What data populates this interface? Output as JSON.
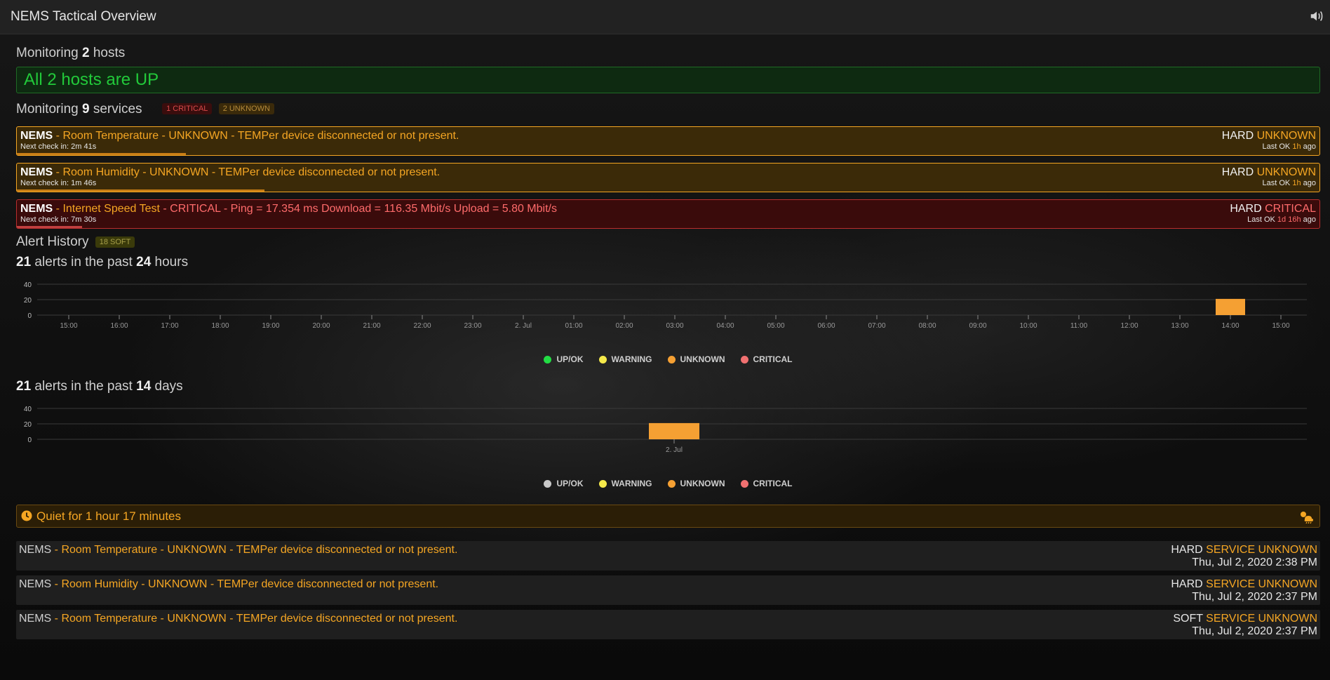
{
  "app_title": "NEMS Tactical Overview",
  "hosts": {
    "prefix": "Monitoring",
    "count": "2",
    "suffix": "hosts",
    "banner": "All 2 hosts are UP"
  },
  "services": {
    "prefix": "Monitoring",
    "count": "9",
    "suffix": "services",
    "badge_critical": "1 CRITICAL",
    "badge_unknown": "2 UNKNOWN"
  },
  "service_rows": [
    {
      "host": "NEMS",
      "sep": " - ",
      "desc": "Room Temperature - UNKNOWN - TEMPer device disconnected or not present.",
      "next_check": "Next check in: 2m 41s",
      "state_type": "HARD ",
      "state": "UNKNOWN",
      "last_ok_prefix": "Last OK ",
      "last_ok_value": "1h",
      "last_ok_suffix": " ago",
      "progress": 0.13
    },
    {
      "host": "NEMS",
      "sep": " - ",
      "desc": "Room Humidity - UNKNOWN - TEMPer device disconnected or not present.",
      "next_check": "Next check in: 1m 46s",
      "state_type": "HARD ",
      "state": "UNKNOWN",
      "last_ok_prefix": "Last OK ",
      "last_ok_value": "1h",
      "last_ok_suffix": " ago",
      "progress": 0.19
    },
    {
      "host": "NEMS",
      "sep": " - ",
      "desc_part1": "Internet Speed Test",
      "desc_part2": " - CRITICAL - Ping = 17.354 ms Download = 116.35 Mbit/s Upload = 5.80 Mbit/s",
      "next_check": "Next check in: 7m 30s",
      "state_type": "HARD ",
      "state": "CRITICAL",
      "last_ok_prefix": "Last OK ",
      "last_ok_value": "1d 16h",
      "last_ok_suffix": " ago",
      "progress": 0.05
    }
  ],
  "alert_history": {
    "title": "Alert History",
    "soft_badge": "18 SOFT"
  },
  "chart24": {
    "count": "21",
    "mid": "alerts in the past",
    "period": "24",
    "unit": "hours"
  },
  "chart14": {
    "count": "21",
    "mid": "alerts in the past",
    "period": "14",
    "unit": "days"
  },
  "legend": [
    {
      "label": "UP/OK",
      "color": "#22dd44"
    },
    {
      "label": "WARNING",
      "color": "#f5e94a"
    },
    {
      "label": "UNKNOWN",
      "color": "#f5a033"
    },
    {
      "label": "CRITICAL",
      "color": "#f07070"
    }
  ],
  "legend2_first_color": "#c8c8c8",
  "chart_data": [
    {
      "type": "bar",
      "categories": [
        "15:00",
        "16:00",
        "17:00",
        "18:00",
        "19:00",
        "20:00",
        "21:00",
        "22:00",
        "23:00",
        "2. Jul",
        "01:00",
        "02:00",
        "03:00",
        "04:00",
        "05:00",
        "06:00",
        "07:00",
        "08:00",
        "09:00",
        "10:00",
        "11:00",
        "12:00",
        "13:00",
        "14:00",
        "15:00"
      ],
      "series": [
        {
          "name": "UP/OK",
          "values": [
            0,
            0,
            0,
            0,
            0,
            0,
            0,
            0,
            0,
            0,
            0,
            0,
            0,
            0,
            0,
            0,
            0,
            0,
            0,
            0,
            0,
            0,
            0,
            0,
            0
          ]
        },
        {
          "name": "WARNING",
          "values": [
            0,
            0,
            0,
            0,
            0,
            0,
            0,
            0,
            0,
            0,
            0,
            0,
            0,
            0,
            0,
            0,
            0,
            0,
            0,
            0,
            0,
            0,
            0,
            0,
            0
          ]
        },
        {
          "name": "UNKNOWN",
          "values": [
            0,
            0,
            0,
            0,
            0,
            0,
            0,
            0,
            0,
            0,
            0,
            0,
            0,
            0,
            0,
            0,
            0,
            0,
            0,
            0,
            0,
            0,
            0,
            21,
            0
          ]
        },
        {
          "name": "CRITICAL",
          "values": [
            0,
            0,
            0,
            0,
            0,
            0,
            0,
            0,
            0,
            0,
            0,
            0,
            0,
            0,
            0,
            0,
            0,
            0,
            0,
            0,
            0,
            0,
            0,
            0,
            0
          ]
        }
      ],
      "yticks": [
        "0",
        "20",
        "40"
      ],
      "ylim": [
        0,
        40
      ],
      "grid": true,
      "legend_position": "bottom"
    },
    {
      "type": "bar",
      "categories": [
        "2. Jul"
      ],
      "series": [
        {
          "name": "UP/OK",
          "values": [
            0
          ]
        },
        {
          "name": "WARNING",
          "values": [
            0
          ]
        },
        {
          "name": "UNKNOWN",
          "values": [
            21
          ]
        },
        {
          "name": "CRITICAL",
          "values": [
            0
          ]
        }
      ],
      "yticks": [
        "0",
        "20",
        "40"
      ],
      "ylim": [
        0,
        40
      ],
      "grid": true,
      "legend_position": "bottom"
    }
  ],
  "quiet": {
    "text": "Quiet for 1 hour 17 minutes"
  },
  "history_rows": [
    {
      "host": "NEMS",
      "sep": " - ",
      "desc": "Room Temperature - UNKNOWN - TEMPer device disconnected or not present.",
      "type": "HARD ",
      "state": "SERVICE UNKNOWN",
      "time": "Thu, Jul 2, 2020 2:38 PM"
    },
    {
      "host": "NEMS",
      "sep": " - ",
      "desc": "Room Humidity - UNKNOWN - TEMPer device disconnected or not present.",
      "type": "HARD ",
      "state": "SERVICE UNKNOWN",
      "time": "Thu, Jul 2, 2020 2:37 PM"
    },
    {
      "host": "NEMS",
      "sep": " - ",
      "desc": "Room Temperature - UNKNOWN - TEMPer device disconnected or not present.",
      "type": "SOFT ",
      "state": "SERVICE UNKNOWN",
      "time": "Thu, Jul 2, 2020 2:37 PM"
    }
  ]
}
